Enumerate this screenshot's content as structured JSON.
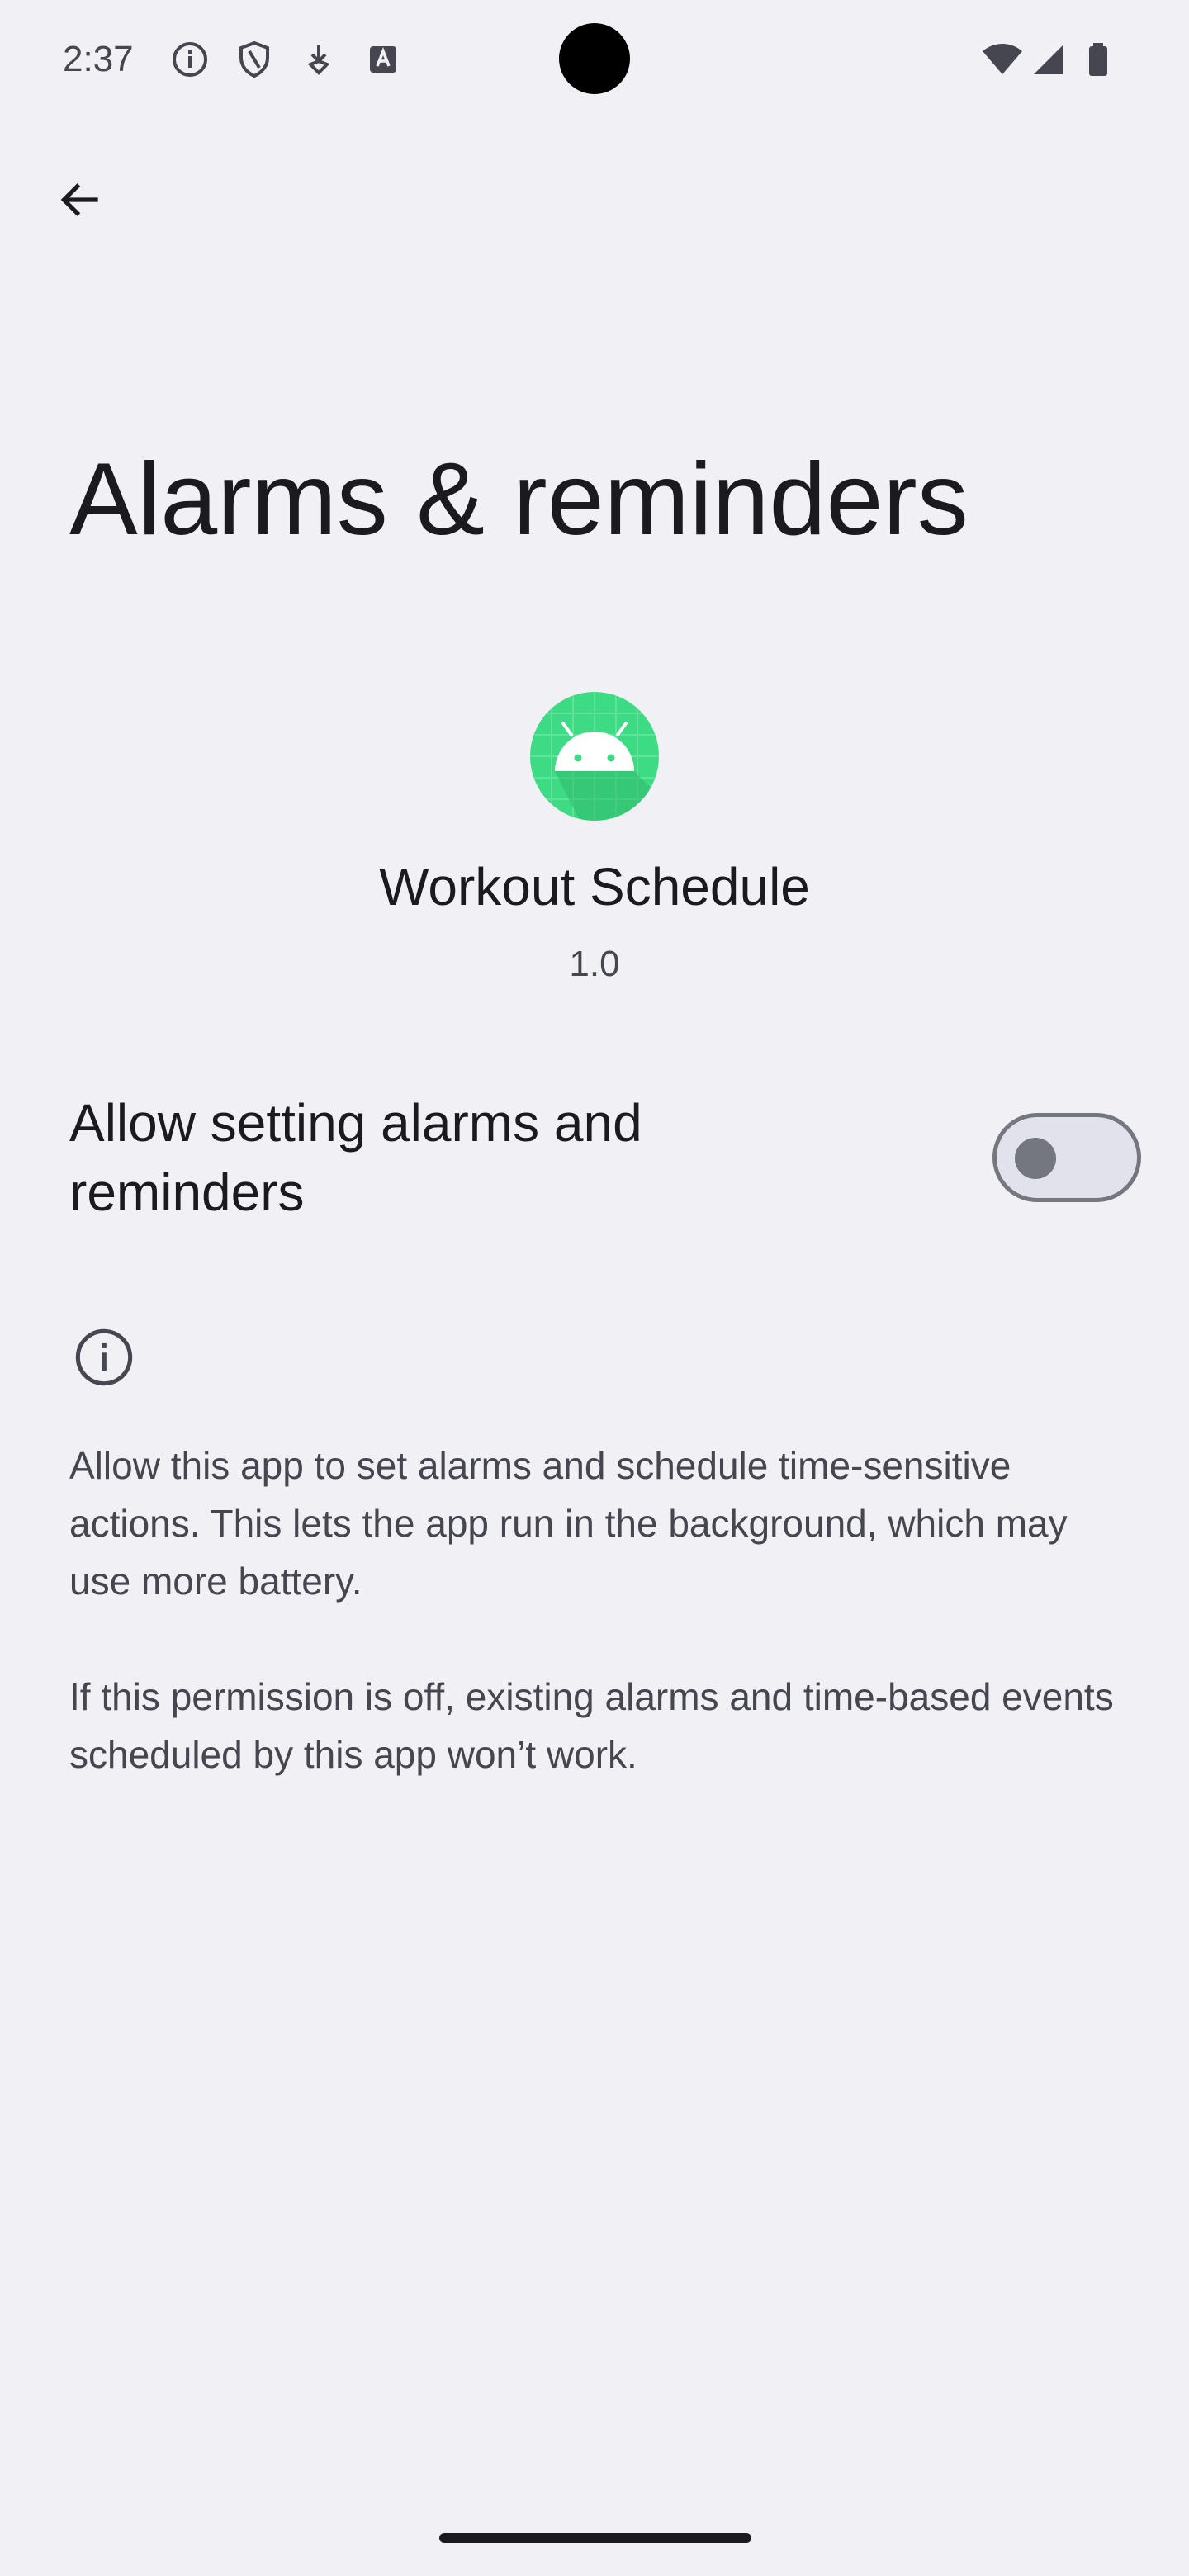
{
  "status_bar": {
    "time": "2:37",
    "left_icons": [
      "info-icon",
      "shield-icon",
      "download-icon",
      "text-icon"
    ],
    "right_icons": [
      "wifi-icon",
      "signal-icon",
      "battery-icon"
    ]
  },
  "nav": {
    "back_icon": "arrow-back-icon"
  },
  "page": {
    "title": "Alarms & reminders"
  },
  "app": {
    "icon": "android-icon",
    "name": "Workout Schedule",
    "version": "1.0"
  },
  "permission": {
    "label": "Allow setting alarms and reminders",
    "enabled": false
  },
  "info": {
    "icon": "info-icon",
    "paragraph1": "Allow this app to set alarms and schedule time-sensitive actions. This lets the app run in the background, which may use more battery.",
    "paragraph2": "If this permission is off, existing alarms and time-based events scheduled by this app won’t work."
  },
  "colors": {
    "background": "#f1f0f4",
    "app_icon_green": "#3ddc84"
  }
}
